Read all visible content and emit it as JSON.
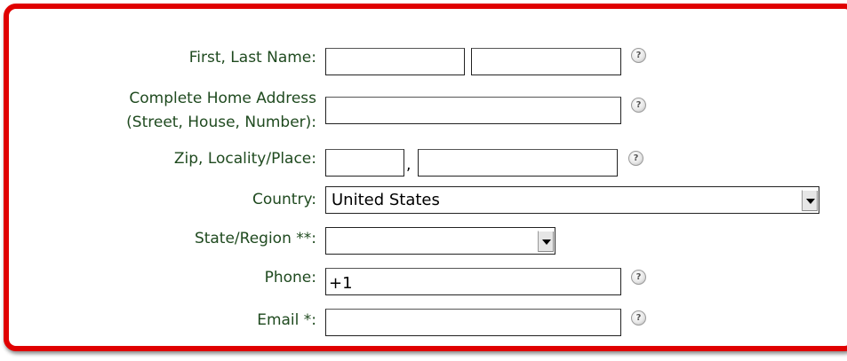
{
  "form": {
    "name_label": "First, Last Name:",
    "first_name_value": "",
    "last_name_value": "",
    "address_label_line1": "Complete Home Address",
    "address_label_line2": "(Street, House, Number):",
    "address_value": "",
    "zip_label": "Zip, Locality/Place:",
    "zip_value": "",
    "comma": ",",
    "locality_value": "",
    "country_label": "Country:",
    "country_selected": "United States",
    "state_label": "State/Region **:",
    "state_selected": "",
    "phone_label": "Phone:",
    "phone_value": "+1",
    "email_label": "Email *:",
    "email_value": "",
    "help_glyph": "?"
  },
  "colors": {
    "frame_border": "#e00000",
    "label_text": "#1f4a1f"
  },
  "icons": {
    "help": "question-help-icon",
    "dropdown": "chevron-down-icon"
  }
}
